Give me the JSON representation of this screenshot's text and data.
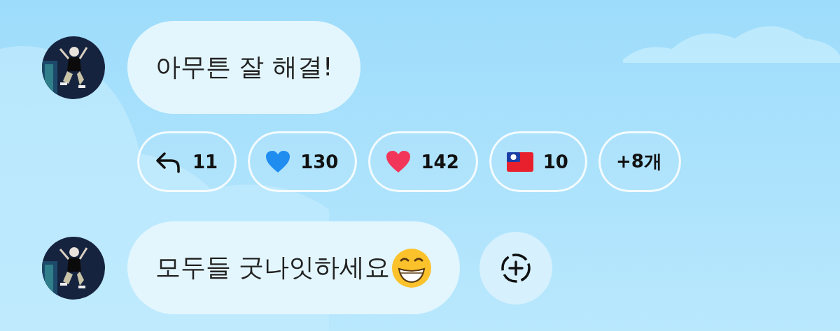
{
  "messages": [
    {
      "kind": "plain",
      "text": "아무튼 잘 해결!",
      "reactions": [
        {
          "kind": "reply",
          "count": "11"
        },
        {
          "kind": "blue-heart",
          "count": "130"
        },
        {
          "kind": "red-heart",
          "count": "142"
        },
        {
          "kind": "taiwan-flag",
          "count": "10"
        },
        {
          "kind": "more",
          "count": "+8개"
        }
      ]
    },
    {
      "kind": "grin",
      "text": "모두들 굿나잇하세요",
      "add_reaction": true
    }
  ]
}
